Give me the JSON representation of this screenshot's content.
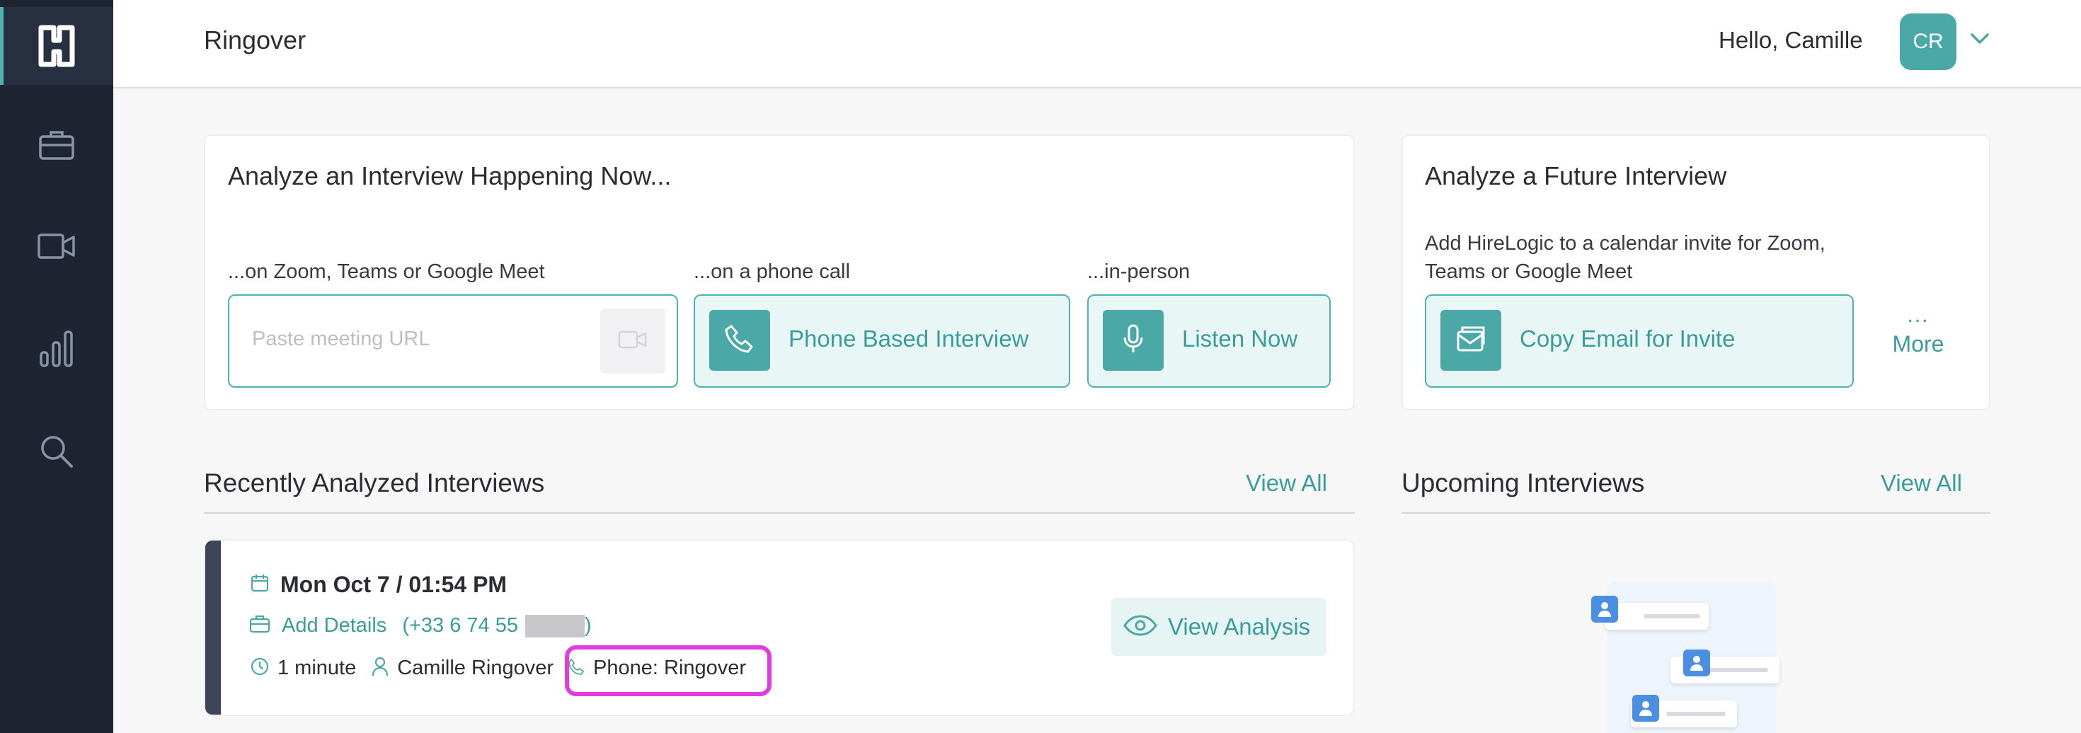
{
  "header": {
    "org_name": "Ringover",
    "greeting": "Hello, Camille",
    "avatar_initials": "CR"
  },
  "analyze_now": {
    "title": "Analyze an Interview Happening Now...",
    "zoom_label": "...on Zoom, Teams or Google Meet",
    "url_placeholder": "Paste meeting URL",
    "url_value": "",
    "phone_label": "...on a phone call",
    "phone_button": "Phone Based Interview",
    "inperson_label": "...in-person",
    "listen_button": "Listen Now"
  },
  "analyze_future": {
    "title": "Analyze a Future Interview",
    "description_line1": "Add HireLogic to a calendar invite for Zoom,",
    "description_line2": "Teams or Google Meet",
    "copy_button": "Copy Email for Invite",
    "more_dots": "...",
    "more_label": "More"
  },
  "recent": {
    "title": "Recently Analyzed Interviews",
    "view_all": "View All",
    "items": [
      {
        "date": "Mon Oct 7 / 01:54 PM",
        "add_details": "Add Details",
        "phone_prefix": "(+33 6 74 55",
        "phone_suffix": ")",
        "duration": "1 minute",
        "interviewer": "Camille Ringover",
        "source": "Phone: Ringover",
        "view_analysis": "View Analysis"
      }
    ]
  },
  "upcoming": {
    "title": "Upcoming Interviews",
    "view_all": "View All"
  },
  "colors": {
    "sidebar_bg": "#1f2432",
    "accent": "#4aa8a6",
    "accent_text": "#3a9d9b",
    "highlight": "#e33be0"
  },
  "icons": {
    "sidebar": [
      "hirelogic-logo-icon",
      "briefcase-icon",
      "video-camera-icon",
      "bar-chart-icon",
      "search-icon"
    ]
  }
}
